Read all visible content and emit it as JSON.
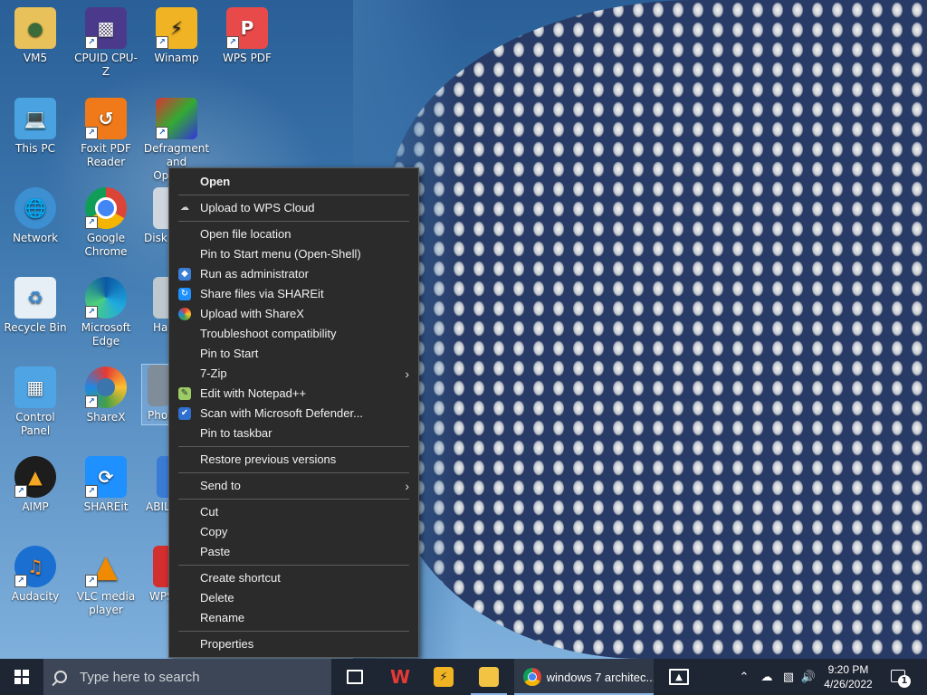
{
  "desktop": {
    "icons": [
      {
        "label": "VM5",
        "icon": "folder-user-icon"
      },
      {
        "label": "CPUID CPU-Z",
        "icon": "cpuz-icon"
      },
      {
        "label": "Winamp",
        "icon": "winamp-icon"
      },
      {
        "label": "WPS PDF",
        "icon": "wps-pdf-icon"
      },
      {
        "label": "This PC",
        "icon": "computer-icon"
      },
      {
        "label": "Foxit PDF Reader",
        "icon": "foxit-icon"
      },
      {
        "label": "Defragment and Optimi...",
        "icon": "defrag-icon"
      },
      {
        "label": "Network",
        "icon": "network-icon"
      },
      {
        "label": "Google Chrome",
        "icon": "chrome-icon"
      },
      {
        "label": "Disk",
        "icon": "disk-icon"
      },
      {
        "label": "Recycle Bin",
        "icon": "recycle-bin-icon"
      },
      {
        "label": "Microsoft Edge",
        "icon": "edge-icon"
      },
      {
        "label": "Har Se",
        "icon": "hard-disk-icon"
      },
      {
        "label": "Control Panel",
        "icon": "control-panel-icon"
      },
      {
        "label": "ShareX",
        "icon": "sharex-icon"
      },
      {
        "label": "Phot",
        "icon": "photo-icon"
      },
      {
        "label": "AIMP",
        "icon": "aimp-icon"
      },
      {
        "label": "SHAREit",
        "icon": "shareit-icon"
      },
      {
        "label": "ABIL",
        "icon": "abil-icon"
      },
      {
        "label": "Audacity",
        "icon": "audacity-icon"
      },
      {
        "label": "VLC media player",
        "icon": "vlc-icon"
      },
      {
        "label": "WPS",
        "icon": "wps-icon"
      }
    ]
  },
  "context_menu": {
    "items": [
      {
        "label": "Open",
        "bold": true
      },
      {
        "sep": true
      },
      {
        "label": "Upload to WPS Cloud",
        "icon": "cloud-icon"
      },
      {
        "sep": true
      },
      {
        "label": "Open file location"
      },
      {
        "label": "Pin to Start menu (Open-Shell)"
      },
      {
        "label": "Run as administrator",
        "icon": "shield-icon"
      },
      {
        "label": "Share files via SHAREit",
        "icon": "shareit-icon"
      },
      {
        "label": "Upload with ShareX",
        "icon": "sharex-icon"
      },
      {
        "label": "Troubleshoot compatibility"
      },
      {
        "label": "Pin to Start"
      },
      {
        "label": "7-Zip",
        "submenu": true
      },
      {
        "label": "Edit with Notepad++",
        "icon": "notepadpp-icon"
      },
      {
        "label": "Scan with Microsoft Defender...",
        "icon": "defender-icon"
      },
      {
        "label": "Pin to taskbar"
      },
      {
        "sep": true
      },
      {
        "label": "Restore previous versions"
      },
      {
        "sep": true
      },
      {
        "label": "Send to",
        "submenu": true
      },
      {
        "sep": true
      },
      {
        "label": "Cut"
      },
      {
        "label": "Copy"
      },
      {
        "label": "Paste"
      },
      {
        "sep": true
      },
      {
        "label": "Create shortcut"
      },
      {
        "label": "Delete"
      },
      {
        "label": "Rename"
      },
      {
        "sep": true
      },
      {
        "label": "Properties"
      }
    ]
  },
  "taskbar": {
    "search_placeholder": "Type here to search",
    "chrome_title": "windows 7 architec...",
    "time": "9:20 PM",
    "date": "4/26/2022",
    "notification_count": "1"
  }
}
